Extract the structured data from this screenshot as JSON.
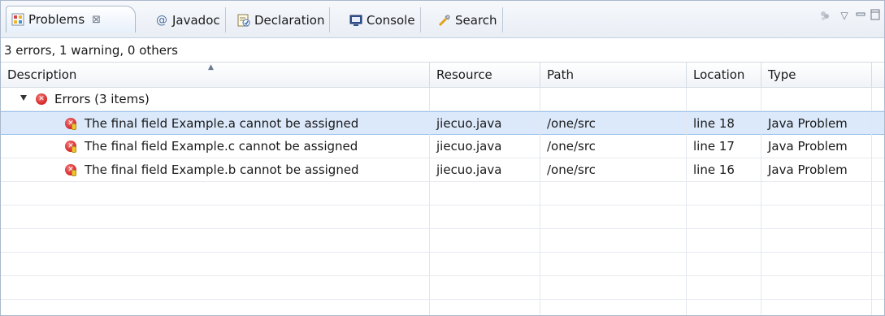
{
  "tabs": [
    {
      "label": "Problems",
      "icon": "problems-icon",
      "active": true
    },
    {
      "label": "Javadoc",
      "icon": "javadoc-icon"
    },
    {
      "label": "Declaration",
      "icon": "declaration-icon"
    },
    {
      "label": "Console",
      "icon": "console-icon"
    },
    {
      "label": "Search",
      "icon": "search-icon"
    }
  ],
  "tab_close_glyph": "⊠",
  "toolbar": {
    "filter_icon": "filter-icon",
    "view_menu_glyph": "▽",
    "minimize_glyph": "▭",
    "maximize_glyph": "□"
  },
  "summary": "3 errors, 1 warning, 0 others",
  "columns": [
    "Description",
    "Resource",
    "Path",
    "Location",
    "Type"
  ],
  "group": {
    "label": "Errors (3 items)",
    "icon": "error-icon"
  },
  "problems": [
    {
      "description": "The final field Example.a cannot be assigned",
      "resource": "jiecuo.java",
      "path": "/one/src",
      "location": "line 18",
      "type": "Java Problem",
      "selected": true
    },
    {
      "description": "The final field Example.c cannot be assigned",
      "resource": "jiecuo.java",
      "path": "/one/src",
      "location": "line 17",
      "type": "Java Problem"
    },
    {
      "description": "The final field Example.b cannot be assigned",
      "resource": "jiecuo.java",
      "path": "/one/src",
      "location": "line 16",
      "type": "Java Problem"
    }
  ],
  "colors": {
    "selection": "#dbe9fb",
    "error": "#d42525",
    "tab_border": "#a9b8cb"
  }
}
